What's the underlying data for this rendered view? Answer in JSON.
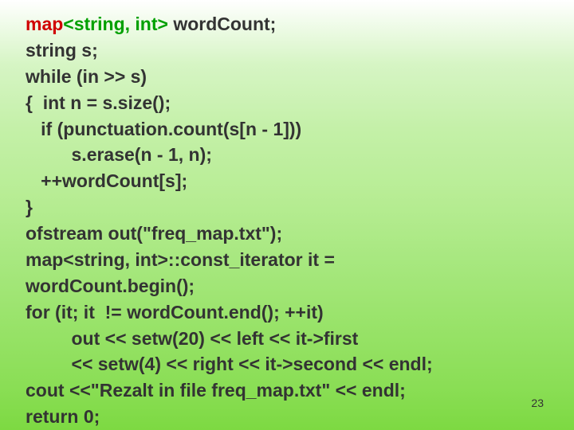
{
  "lines": {
    "l1a": "map",
    "l1b": "<string, int>",
    "l1c": " wordCount;",
    "l2": "string s;",
    "l3": "while (in >> s)",
    "l4": "{  int n = s.size();",
    "l5": "   if (punctuation.count(s[n - 1]))",
    "l6": "         s.erase(n - 1, n);",
    "l7": "   ++wordCount[s];",
    "l8": "}",
    "l9": "ofstream out(\"freq_map.txt\");",
    "l10": "map<string, int>::const_iterator it =",
    "l11": "wordCount.begin();",
    "l12": "for (it; it  != wordCount.end(); ++it)",
    "l13": "         out << setw(20) << left << it->first",
    "l14": "         << setw(4) << right << it->second << endl;",
    "l15": "cout <<\"Rezalt in file freq_map.txt\" << endl;",
    "l16": "return 0;"
  },
  "pagenum": "23"
}
